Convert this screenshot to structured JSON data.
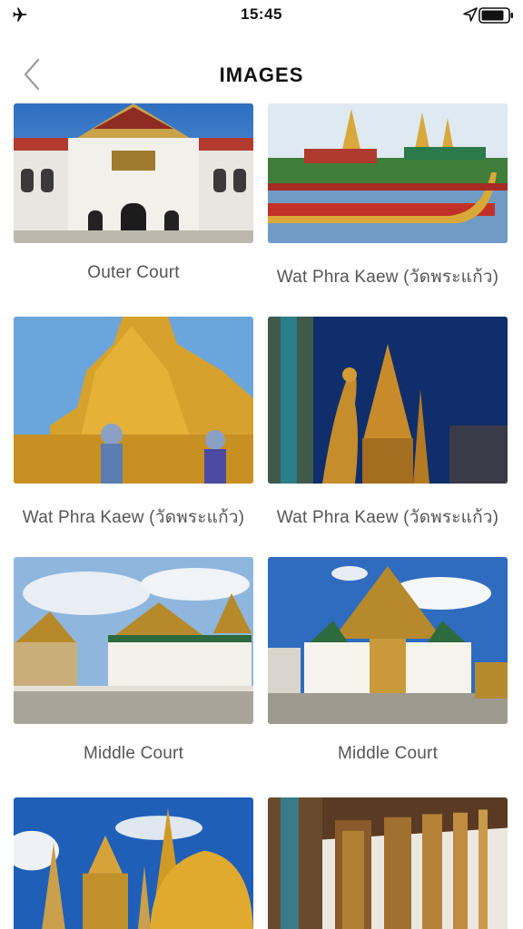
{
  "status_bar": {
    "time": "15:45",
    "left_icon": "airplane-icon",
    "right_icons": [
      "location-arrow-icon",
      "battery-icon"
    ]
  },
  "nav": {
    "title": "IMAGES",
    "back_icon": "chevron-left-icon"
  },
  "gallery": [
    {
      "caption": "Outer Court",
      "icon": "palace-photo"
    },
    {
      "caption": "Wat Phra Kaew (วัดพระแก้ว)",
      "icon": "royal-barge-photo"
    },
    {
      "caption": "Wat Phra Kaew (วัดพระแก้ว)",
      "icon": "golden-chedi-demons-photo"
    },
    {
      "caption": "Wat Phra Kaew (วัดพระแก้ว)",
      "icon": "kinnara-statue-photo"
    },
    {
      "caption": "Middle Court",
      "icon": "hall-white-gold-photo"
    },
    {
      "caption": "Middle Court",
      "icon": "throne-hall-photo"
    },
    {
      "caption": "",
      "icon": "golden-stupa-photo"
    },
    {
      "caption": "",
      "icon": "mosaic-pillars-photo"
    }
  ],
  "colors": {
    "title": "#111111",
    "caption": "#555555",
    "back_chevron": "#9a9a9a"
  }
}
